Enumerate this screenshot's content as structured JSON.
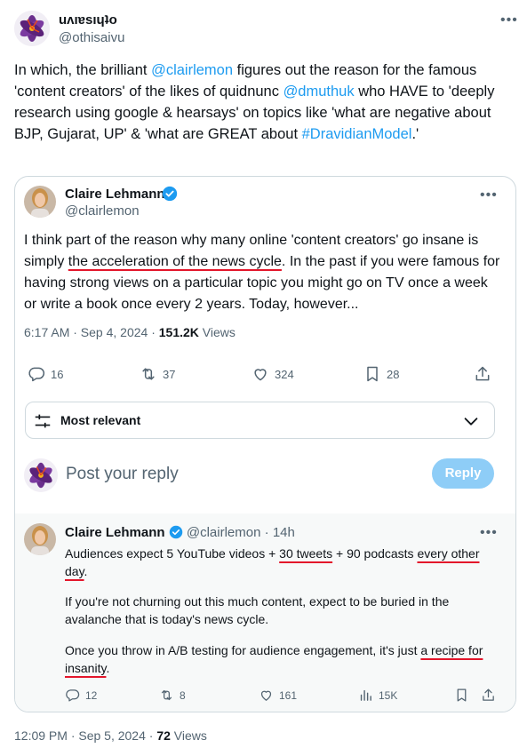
{
  "tweet": {
    "display_name": "uʌıɐsıɥʇo",
    "handle": "@othisaivu",
    "more_icon": "more-horizontal-icon",
    "text_parts": {
      "p1": "In which, the brilliant ",
      "mention1": "@clairlemon",
      "p2": " figures out the reason for the famous 'content creators' of the likes of quidnunc ",
      "mention2": "@dmuthuk",
      "p3": " who HAVE to 'deeply research using google & hearsays' on topics like 'what are negative about BJP, Gujarat, UP' & 'what are GREAT about ",
      "hashtag": "#DravidianModel",
      "p4": ".'"
    },
    "timestamp": "12:09 PM · Sep 5, 2024 · ",
    "views_count": "72",
    "views_label": " Views"
  },
  "quoted": {
    "display_name": "Claire Lehmann",
    "handle": "@clairlemon",
    "verified_icon": "verified-badge-icon",
    "text_parts": {
      "p1": "I think part of the reason why many online 'content creators' go insane is simply ",
      "highlight": "the acceleration of the news cycle",
      "p2": ". In the past if you were famous for having strong views on a particular topic you might go on TV once a week or write a book once every 2 years. Today, however..."
    },
    "timestamp": "6:17 AM · Sep 4, 2024 · ",
    "views_count": "151.2K",
    "views_label": " Views",
    "actions": {
      "replies": "16",
      "reposts": "37",
      "likes": "324",
      "bookmarks": "28"
    },
    "sort": {
      "label": "Most relevant",
      "icon": "filter-sliders-icon",
      "chevron": "chevron-down-icon"
    },
    "compose": {
      "placeholder": "Post your reply",
      "button": "Reply"
    },
    "reply": {
      "display_name": "Claire Lehmann",
      "handle": "@clairlemon",
      "time": "14h",
      "para1_a": "Audiences expect 5 YouTube videos + ",
      "para1_b": "30 tweets",
      "para1_c": " + 90 podcasts ",
      "para1_d": "every other day",
      "para1_e": ".",
      "para2": "If you're not churning out this much content, expect to be buried in the avalanche that is today's news cycle.",
      "para3_a": "Once you throw in A/B testing for audience engagement, it's just ",
      "para3_b": "a recipe for insanity",
      "para3_c": ".",
      "actions": {
        "replies": "12",
        "reposts": "8",
        "likes": "161",
        "views": "15K"
      }
    }
  },
  "colors": {
    "accent": "#1d9bf0",
    "underline": "#e3162b",
    "reply_button": "#8ecdf7",
    "text_secondary": "#536471"
  }
}
